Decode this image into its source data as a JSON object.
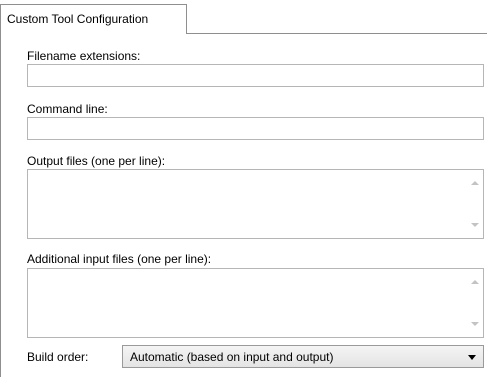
{
  "tab": {
    "label": "Custom Tool Configuration"
  },
  "fields": {
    "filename_extensions": {
      "label": "Filename extensions:",
      "value": ""
    },
    "command_line": {
      "label": "Command line:",
      "value": ""
    },
    "output_files": {
      "label": "Output files (one per line):",
      "value": ""
    },
    "additional_input_files": {
      "label": "Additional input files (one per line):",
      "value": ""
    },
    "build_order": {
      "label": "Build order:",
      "selected": "Automatic (based on input and output)"
    }
  },
  "icons": {
    "scroll_up": "scroll-up-arrow-icon",
    "scroll_down": "scroll-down-arrow-icon",
    "dropdown": "chevron-down-icon"
  },
  "colors": {
    "border": "#8f8f8f",
    "input_border": "#b6b6b6",
    "scroll_arrow": "#c3c3c3"
  }
}
